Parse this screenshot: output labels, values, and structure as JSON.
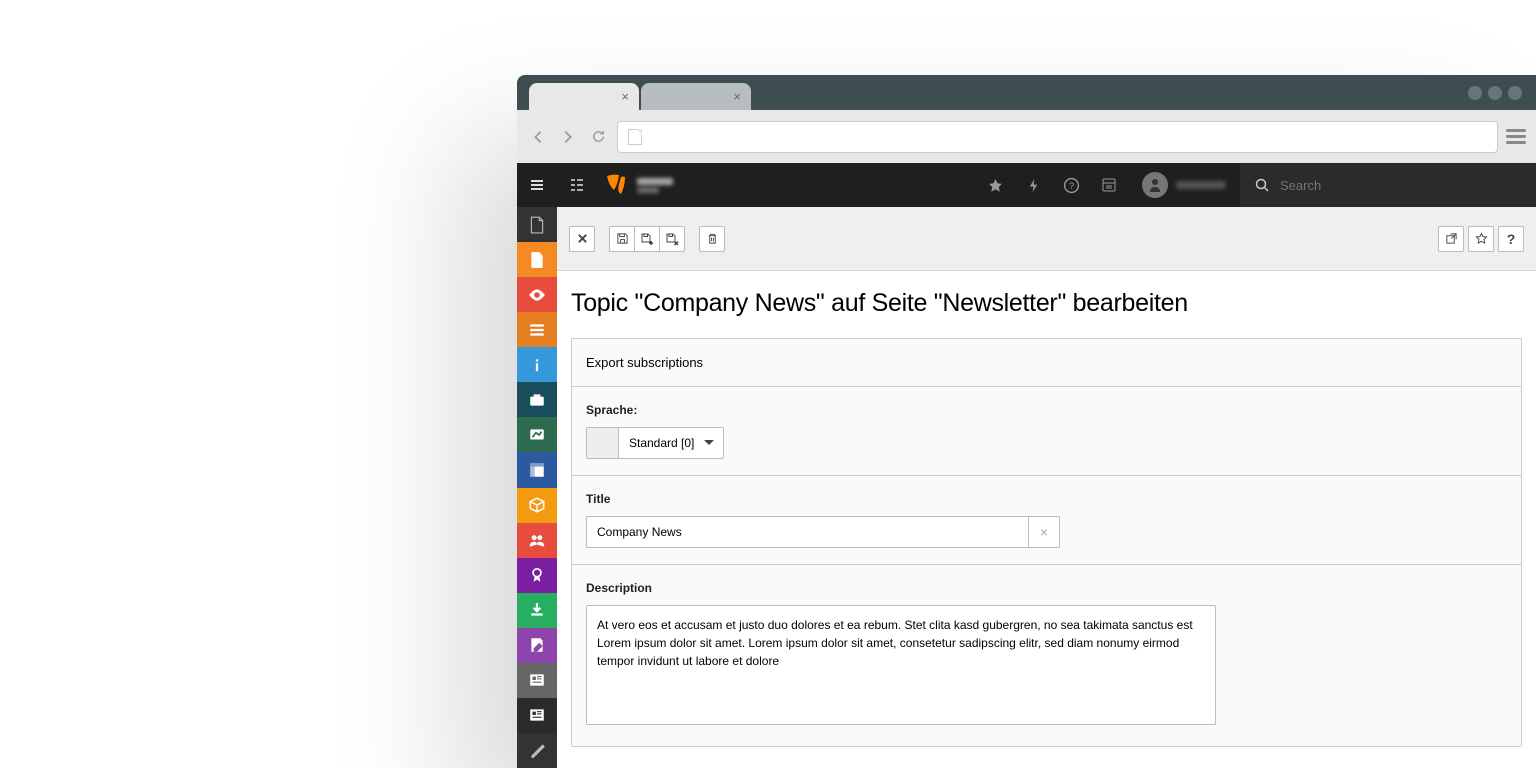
{
  "browser": {
    "tab_close": "×"
  },
  "search": {
    "placeholder": "Search"
  },
  "page": {
    "title": "Topic \"Company News\" auf Seite \"Newsletter\" bearbeiten"
  },
  "form": {
    "tab_label": "Export subscriptions",
    "language": {
      "label": "Sprache:",
      "selected": "Standard [0]"
    },
    "title": {
      "label": "Title",
      "value": "Company News"
    },
    "description": {
      "label": "Description",
      "value": "At vero eos et accusam et justo duo dolores et ea rebum. Stet clita kasd gubergren, no sea takimata sanctus est Lorem ipsum dolor sit amet. Lorem ipsum dolor sit amet, consetetur sadipscing elitr, sed diam nonumy eirmod tempor invidunt ut labore et dolore"
    }
  },
  "sidebar_modules": [
    {
      "id": "file",
      "color": "transparent"
    },
    {
      "id": "page",
      "color": "#f38a24"
    },
    {
      "id": "view",
      "color": "#e74c3c"
    },
    {
      "id": "list",
      "color": "#e67e22"
    },
    {
      "id": "info",
      "color": "#3498db"
    },
    {
      "id": "workspace",
      "color": "#1a4d5c"
    },
    {
      "id": "presentation",
      "color": "#2d6a4f"
    },
    {
      "id": "template",
      "color": "#2c5aa0"
    },
    {
      "id": "package",
      "color": "#f39c12"
    },
    {
      "id": "users",
      "color": "#e74c3c"
    },
    {
      "id": "award",
      "color": "#7b1fa2"
    },
    {
      "id": "download",
      "color": "#27ae60"
    },
    {
      "id": "edit",
      "color": "#8e44ad"
    },
    {
      "id": "newspaper1",
      "color": "#666"
    },
    {
      "id": "newspaper2",
      "color": "#333"
    },
    {
      "id": "pen",
      "color": "transparent"
    }
  ]
}
